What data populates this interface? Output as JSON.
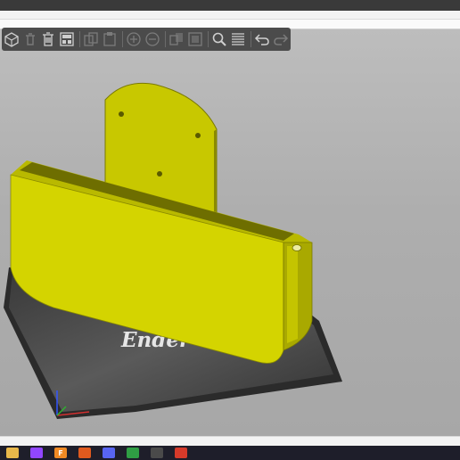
{
  "window": {
    "title_bar_color": "#3a3a3a"
  },
  "toolbar": {
    "items": [
      {
        "icon": "add-object-icon",
        "enabled": true
      },
      {
        "icon": "delete-icon",
        "enabled": false
      },
      {
        "icon": "delete-all-icon",
        "enabled": true
      },
      {
        "icon": "arrange-icon",
        "enabled": true
      },
      {
        "icon": "copy-icon",
        "enabled": false
      },
      {
        "icon": "paste-icon",
        "enabled": false
      },
      {
        "icon": "add-instance-icon",
        "enabled": false
      },
      {
        "icon": "remove-instance-icon",
        "enabled": false
      },
      {
        "icon": "split-objects-icon",
        "enabled": false
      },
      {
        "icon": "split-parts-icon",
        "enabled": false
      },
      {
        "icon": "search-icon",
        "enabled": true
      },
      {
        "icon": "layers-editing-icon",
        "enabled": true
      },
      {
        "icon": "undo-icon",
        "enabled": true
      },
      {
        "icon": "redo-icon",
        "enabled": false
      }
    ]
  },
  "scene": {
    "bed_logo": "Ender",
    "model_color": "#d4d400",
    "bed_color": "#2b2b2b"
  },
  "taskbar": {
    "apps": [
      {
        "icon": "folder-icon",
        "color": "#e8b84a",
        "glyph": ""
      },
      {
        "icon": "twitch-icon",
        "color": "#9146ff",
        "glyph": ""
      },
      {
        "icon": "f-app-icon",
        "color": "#f08a24",
        "glyph": "F"
      },
      {
        "icon": "slicer-icon",
        "color": "#e05a1e",
        "glyph": ""
      },
      {
        "icon": "discord-icon",
        "color": "#5865f2",
        "glyph": ""
      },
      {
        "icon": "chrome-icon",
        "color": "#2f9e44",
        "glyph": ""
      },
      {
        "icon": "chrome-alt-icon",
        "color": "#4a4a4a",
        "glyph": ""
      },
      {
        "icon": "app-icon",
        "color": "#d63a2a",
        "glyph": ""
      }
    ]
  }
}
